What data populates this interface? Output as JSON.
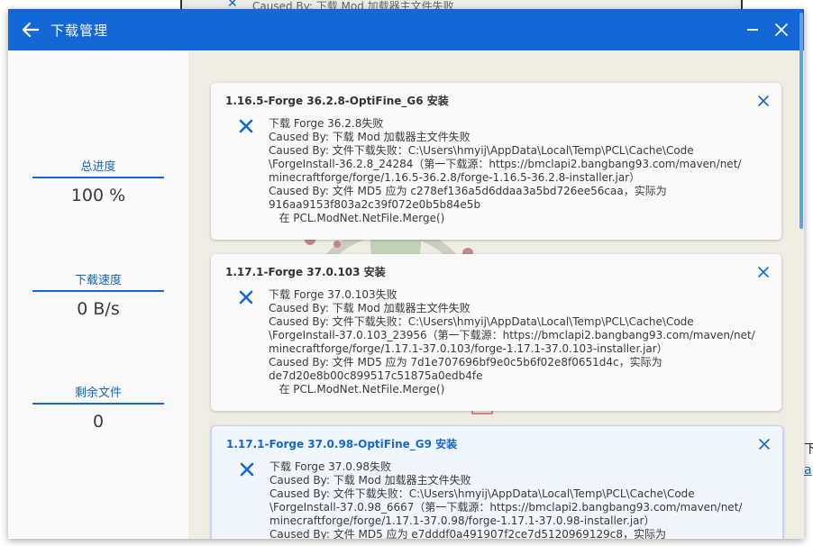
{
  "background": {
    "window_text": "Caused By: 下载 Mod 加载器主文件失败",
    "outside_text_1": "下",
    "outside_text_2": "a"
  },
  "window": {
    "title": "下载管理",
    "accent_color": "#1368d6"
  },
  "stats": [
    {
      "label": "总进度",
      "value": "100 %"
    },
    {
      "label": "下载速度",
      "value": "0 B/s"
    },
    {
      "label": "剩余文件",
      "value": "0"
    }
  ],
  "cards": [
    {
      "title": "1.16.5-Forge 36.2.8-OptiFine_G6 安装",
      "lines": [
        "下载 Forge 36.2.8失败",
        "Caused By: 下载 Mod 加载器主文件失败",
        "Caused By: 文件下载失败：C:\\Users\\hmyij\\AppData\\Local\\Temp\\PCL\\Cache\\Code",
        "\\ForgeInstall-36.2.8_24284（第一下载源：https://bmclapi2.bangbang93.com/maven/net/",
        "minecraftforge/forge/1.16.5-36.2.8/forge-1.16.5-36.2.8-installer.jar）",
        "Caused By: 文件 MD5 应为 c278ef136a5d6ddaa3a5bd726ee56caa，实际为",
        "916aa9153f803a2c39f072e0b5b84e5b",
        "   在 PCL.ModNet.NetFile.Merge()"
      ]
    },
    {
      "title": "1.17.1-Forge 37.0.103 安装",
      "lines": [
        "下载 Forge 37.0.103失败",
        "Caused By: 下载 Mod 加载器主文件失败",
        "Caused By: 文件下载失败：C:\\Users\\hmyij\\AppData\\Local\\Temp\\PCL\\Cache\\Code",
        "\\ForgeInstall-37.0.103_23956（第一下载源：https://bmclapi2.bangbang93.com/maven/net/",
        "minecraftforge/forge/1.17.1-37.0.103/forge-1.17.1-37.0.103-installer.jar）",
        "Caused By: 文件 MD5 应为 7d1e707696bf9e0c5b6f02e8f0651d4c，实际为",
        "de7d20e8b00c899517c51875a0edb4fe",
        "   在 PCL.ModNet.NetFile.Merge()"
      ]
    },
    {
      "title": "1.17.1-Forge 37.0.98-OptiFine_G9 安装",
      "lines": [
        "下载 Forge 37.0.98失败",
        "Caused By: 下载 Mod 加载器主文件失败",
        "Caused By: 文件下载失败：C:\\Users\\hmyij\\AppData\\Local\\Temp\\PCL\\Cache\\Code",
        "\\ForgeInstall-37.0.98_6667（第一下载源：https://bmclapi2.bangbang93.com/maven/net/",
        "minecraftforge/forge/1.17.1-37.0.98/forge-1.17.1-37.0.98-installer.jar）",
        "Caused By: 文件 MD5 应为 e7dddf0a491907f2ce7d5120969129c8，实际为"
      ]
    }
  ]
}
